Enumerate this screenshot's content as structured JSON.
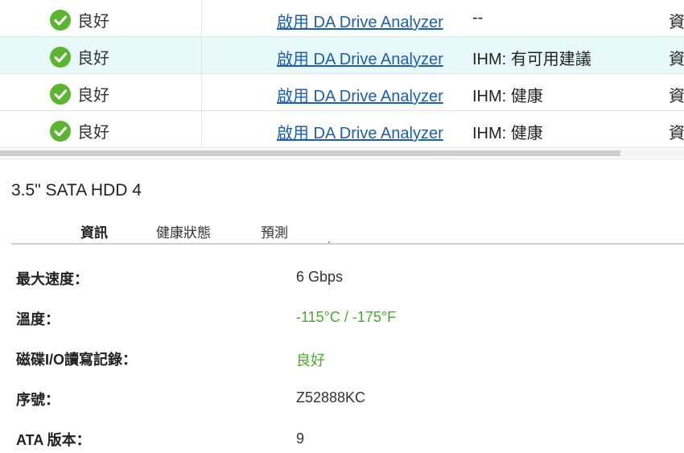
{
  "table": {
    "rows": [
      {
        "status": "良好",
        "link": "啟用 DA Drive Analyzer",
        "ihm": "--",
        "trunc": "資",
        "highlight": false
      },
      {
        "status": "良好",
        "link": "啟用 DA Drive Analyzer",
        "ihm": "IHM:  有可用建議",
        "trunc": "資",
        "highlight": true
      },
      {
        "status": "良好",
        "link": "啟用 DA Drive Analyzer",
        "ihm": "IHM:  健康",
        "trunc": "資",
        "highlight": false
      },
      {
        "status": "良好",
        "link": "啟用 DA Drive Analyzer",
        "ihm": "IHM:  健康",
        "trunc": "資",
        "highlight": false
      }
    ]
  },
  "detail": {
    "title": "3.5\" SATA HDD 4",
    "tabs": [
      "資訊",
      "健康狀態",
      "預測"
    ],
    "active_tab": "資訊",
    "rows": [
      {
        "label": "最大速度：",
        "value": "6 Gbps",
        "green": false
      },
      {
        "label": "溫度：",
        "value": "-115°C / -175°F",
        "green": true
      },
      {
        "label": "磁碟I/O讀寫記錄：",
        "value": "良好",
        "green": true
      },
      {
        "label": "序號：",
        "value": "Z52888KC",
        "green": false
      },
      {
        "label": "ATA 版本：",
        "value": "9",
        "green": false
      }
    ]
  },
  "colors": {
    "ok_green": "#5cb531",
    "link_blue": "#1a5fb4",
    "value_green": "#4caa2a",
    "row_highlight": "#e8f9fb"
  },
  "icons": {
    "status_ok": "check-circle-icon"
  }
}
